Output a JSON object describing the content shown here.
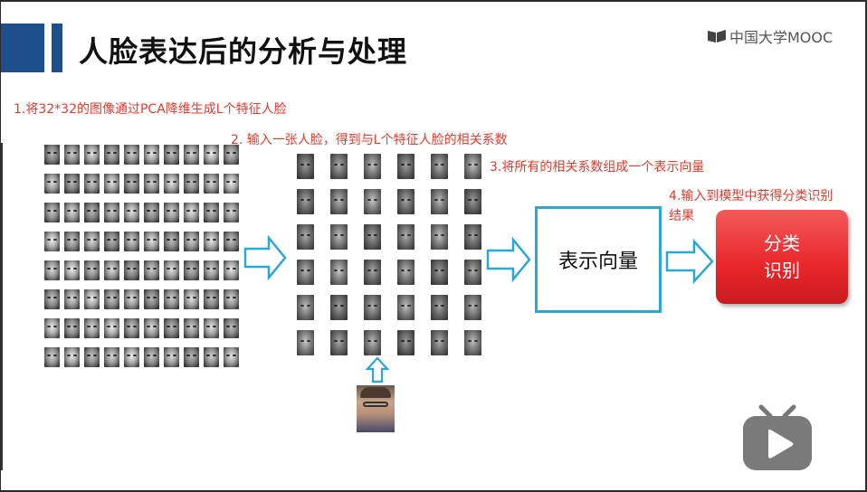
{
  "slide": {
    "title": "人脸表达后的分析与处理",
    "logo_text": "中国大学MOOC",
    "step1": "1.将32*32的图像通过PCA降维生成L个特征人脸",
    "step2": "2. 输入一张人脸，得到与L个特征人脸的相关系数",
    "step3": "3.将所有的相关系数组成一个表示向量",
    "step4_line1": "4.输入到模型中获得分类识别",
    "step4_line2": "结果",
    "vector_box": "表示向量",
    "classify_line1": "分类",
    "classify_line2": "识别"
  },
  "face_grid_left": {
    "rows": 8,
    "cols": 10
  },
  "face_grid_eigen": {
    "rows": 6,
    "cols": 6
  },
  "colors": {
    "accent_blue": "#1f4e8c",
    "arrow_blue": "#2ba7d6",
    "note_red": "#e53a2e",
    "classify_red": "#e8262a"
  },
  "icons": [
    "mooc-logo-icon",
    "arrow-right-icon",
    "arrow-up-icon",
    "bilibili-play-icon"
  ]
}
